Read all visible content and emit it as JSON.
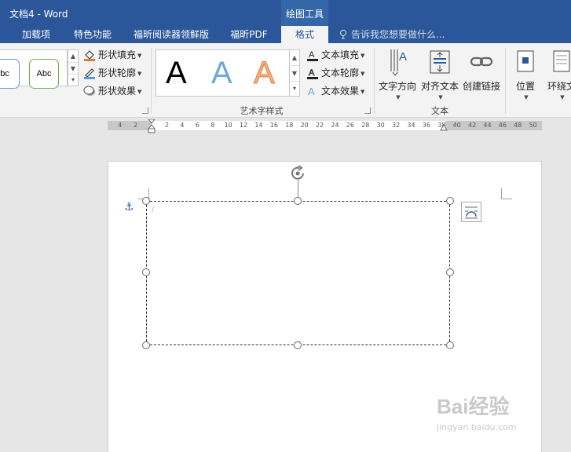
{
  "window": {
    "title": "文档4 - Word",
    "context_group": "绘图工具"
  },
  "tabs": [
    "加载项",
    "特色功能",
    "福昕阅读器领鲜版",
    "福昕PDF",
    "格式"
  ],
  "tell_me": {
    "placeholder": "告诉我您想要做什么..."
  },
  "shape_styles": {
    "swatch_left": "bc",
    "swatch_main": "Abc",
    "fill": "形状填充",
    "outline": "形状轮廓",
    "effects": "形状效果"
  },
  "wordart": {
    "letters": [
      "A",
      "A",
      "A"
    ],
    "text_fill": "文本填充",
    "text_outline": "文本轮廓",
    "text_effects": "文本效果",
    "group_label": "艺术字样式"
  },
  "text_group": {
    "direction": "文字方向",
    "align": "对齐文本",
    "link": "创建链接",
    "group_label": "文本"
  },
  "arrange": {
    "position": "位置",
    "wrap": "环绕文"
  },
  "ruler": {
    "left": [
      "4",
      "2"
    ],
    "right": [
      "2",
      "4",
      "6",
      "8",
      "10",
      "12",
      "14",
      "16",
      "18",
      "20",
      "22",
      "24",
      "26",
      "28",
      "30",
      "32",
      "34",
      "36",
      "38",
      "40",
      "42",
      "44",
      "46",
      "48",
      "50"
    ]
  },
  "watermark": {
    "main": "Bai经验",
    "sub": "jingyan.baidu.com"
  },
  "colors": {
    "ribbon_blue": "#2b579a",
    "accent_orange": "#e07b39",
    "wordart_blue": "#6fa8dc"
  }
}
